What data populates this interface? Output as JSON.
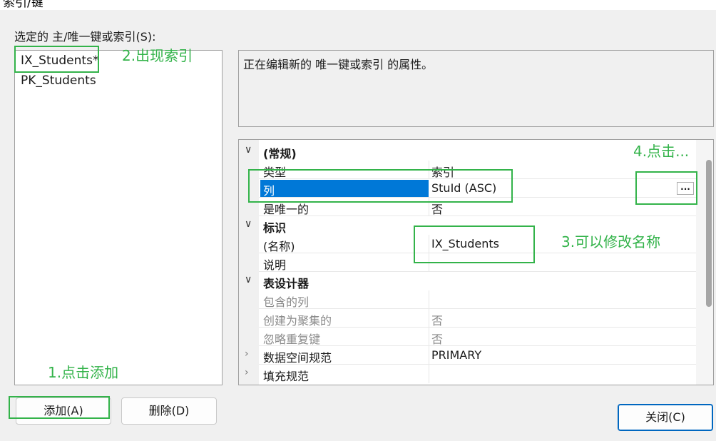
{
  "window": {
    "title": "索引/键"
  },
  "selected_label": "选定的 主/唯一键或索引(S):",
  "index_list": [
    "IX_Students*",
    "PK_Students"
  ],
  "description": "正在编辑新的 唯一键或索引 的属性。",
  "properties": {
    "general": {
      "category": "(常规)",
      "rows": [
        {
          "name": "类型",
          "value": "索引"
        },
        {
          "name": "列",
          "value": "StuId (ASC)"
        },
        {
          "name": "是唯一的",
          "value": "否"
        }
      ]
    },
    "identity": {
      "category": "标识",
      "rows": [
        {
          "name": "(名称)",
          "value": "IX_Students"
        },
        {
          "name": "说明",
          "value": ""
        }
      ]
    },
    "designer": {
      "category": "表设计器",
      "rows": [
        {
          "name": "包含的列",
          "value": ""
        },
        {
          "name": "创建为聚集的",
          "value": "否"
        },
        {
          "name": "忽略重复键",
          "value": "否"
        },
        {
          "name": "数据空间规范",
          "value": "PRIMARY"
        },
        {
          "name": "填充规范",
          "value": ""
        }
      ]
    },
    "ellipsis": "..."
  },
  "buttons": {
    "add": "添加(A)",
    "delete": "删除(D)",
    "close": "关闭(C)"
  },
  "annotations": {
    "a1": "1.点击添加",
    "a2": "2.出现索引",
    "a3": "3.可以修改名称",
    "a4": "4.点击..."
  },
  "colors": {
    "selection": "#0078d7",
    "annotation": "#33b34a"
  }
}
